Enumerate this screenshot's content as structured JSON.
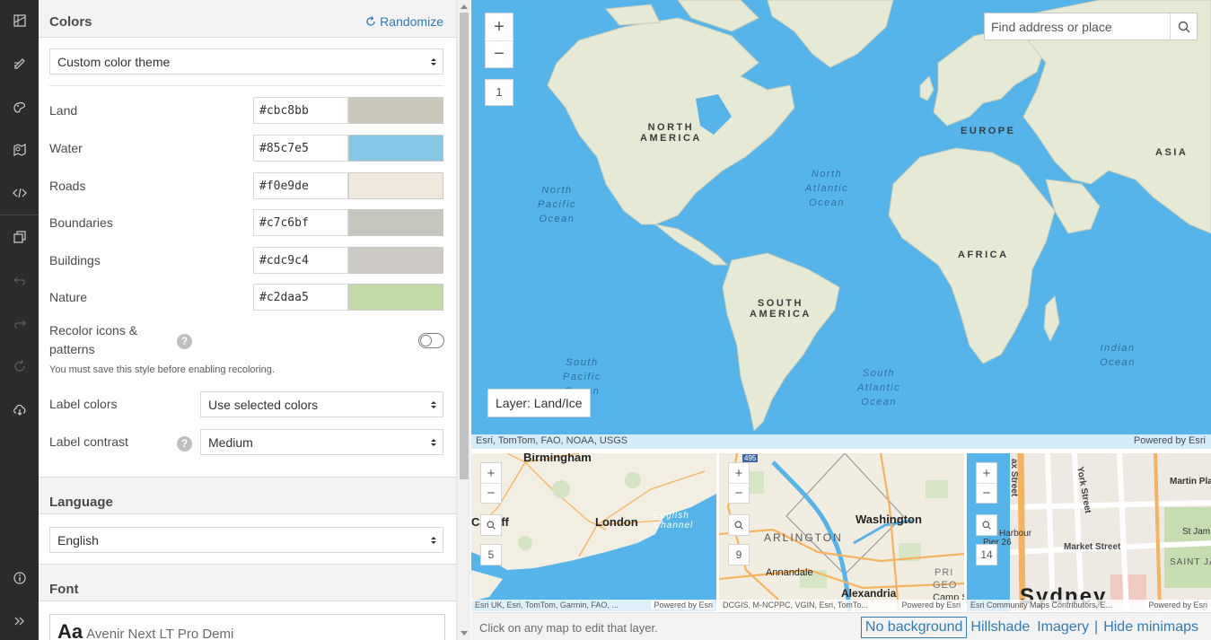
{
  "rail": {
    "icons": [
      "basemap-icon",
      "edit-icon",
      "style-icon",
      "map-layers-icon",
      "code-icon",
      "copy-icon",
      "undo-icon",
      "redo-icon",
      "reset-icon",
      "cloud-save-icon",
      "info-icon",
      "expand-icon"
    ]
  },
  "colors": {
    "title": "Colors",
    "randomize": "Randomize",
    "theme_value": "Custom color theme",
    "rows": [
      {
        "label": "Land",
        "hex": "#cbc8bb"
      },
      {
        "label": "Water",
        "hex": "#85c7e5"
      },
      {
        "label": "Roads",
        "hex": "#f0e9de"
      },
      {
        "label": "Boundaries",
        "hex": "#c7c6bf"
      },
      {
        "label": "Buildings",
        "hex": "#cdc9c4"
      },
      {
        "label": "Nature",
        "hex": "#c2daa5"
      }
    ],
    "recolor_label_1": "Recolor icons &",
    "recolor_label_2": "patterns",
    "recolor_note": "You must save this style before enabling recoloring.",
    "recolor_enabled": false,
    "label_colors_label": "Label colors",
    "label_colors_value": "Use selected colors",
    "label_contrast_label": "Label contrast",
    "label_contrast_value": "Medium"
  },
  "language": {
    "title": "Language",
    "value": "English"
  },
  "font": {
    "title": "Font",
    "sample": "Aa",
    "name": "Avenir Next LT Pro Demi"
  },
  "map": {
    "search_placeholder": "Find address or place",
    "zoom_level": "1",
    "layer_tip": "Layer: Land/Ice",
    "attribution": "Esri, TomTom, FAO, NOAA, USGS",
    "powered_by": "Powered by Esri",
    "labels": {
      "north_america_1": "NORTH",
      "north_america_2": "AMERICA",
      "south_america_1": "SOUTH",
      "south_america_2": "AMERICA",
      "europe": "EUROPE",
      "asia": "ASIA",
      "africa": "AFRICA",
      "north_pacific": [
        "North",
        "Pacific",
        "Ocean"
      ],
      "north_atlantic": [
        "North",
        "Atlantic",
        "Ocean"
      ],
      "south_pacific": [
        "South",
        "Pacific",
        "Ocean"
      ],
      "south_atlantic": [
        "South",
        "Atlantic",
        "Ocean"
      ],
      "indian": [
        "Indian",
        "Ocean"
      ]
    }
  },
  "minimaps": [
    {
      "zoom": "5",
      "attribution": "Esri UK, Esri, TomTom, Garmin, FAO, ...",
      "powered_by": "Powered by Esri",
      "labels": {
        "birmingham": "Birmingham",
        "london": "London",
        "channel_1": "English",
        "channel_2": "Channel",
        "cardiff": "Cardiff"
      }
    },
    {
      "zoom": "9",
      "attribution": "DCGIS, M-NCPPC, VGIN, Esri, TomTo...",
      "powered_by": "Powered by Esri",
      "labels": {
        "washington": "Washington",
        "arlington": "ARLINGTON",
        "annandale": "Annandale",
        "alexandria": "Alexandria",
        "camp": "Camp S",
        "pri": "PRI",
        "geo": "GEO",
        "route": "495"
      }
    },
    {
      "zoom": "14",
      "attribution": "Esri Community Maps Contributors, E...",
      "powered_by": "Powered by Esri",
      "labels": {
        "sydney": "Sydney",
        "market": "Market Street",
        "york": "York Street",
        "martin": "Martin Pla",
        "harbour": "Harbour",
        "pier": "Pier 26",
        "st_james": "St Jam",
        "saint_ja": "SAINT JA",
        "kent": "ax Street"
      }
    }
  ],
  "footer": {
    "hint": "Click on any map to edit that layer.",
    "no_background": "No background",
    "hillshade": "Hillshade",
    "imagery": "Imagery",
    "hide_minimaps": "Hide minimaps"
  },
  "palette": {
    "water": "#55b4ea",
    "land": "#e4e8d3",
    "accent": "#2f7bb5"
  }
}
